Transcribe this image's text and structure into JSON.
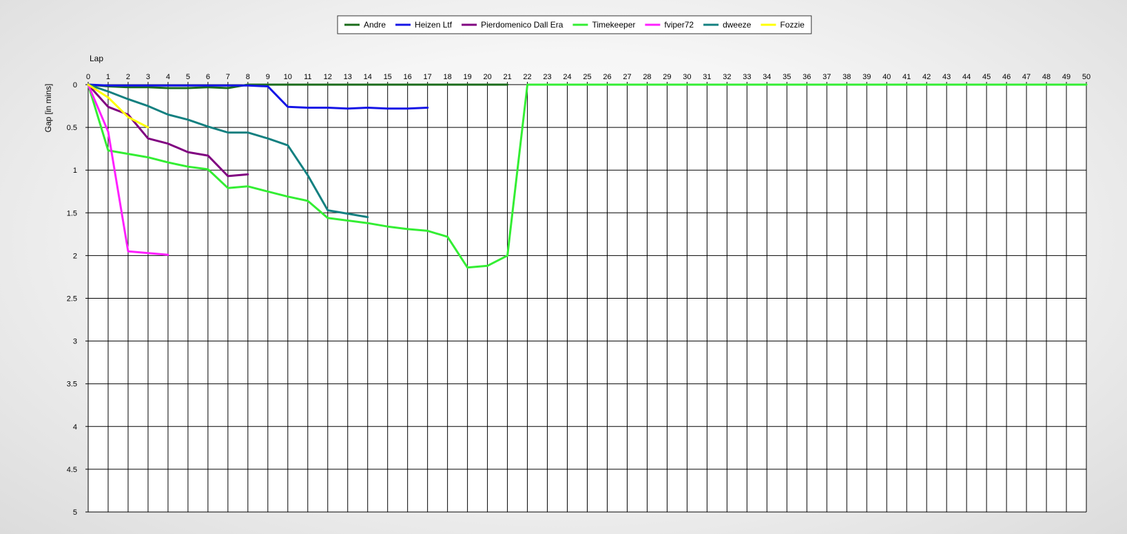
{
  "chart_data": {
    "type": "line",
    "xlabel": "Lap",
    "ylabel": "Gap [in mins]",
    "xlim": [
      0,
      50
    ],
    "ylim": [
      0,
      5
    ],
    "y_inverted": true,
    "x_ticks": [
      0,
      1,
      2,
      3,
      4,
      5,
      6,
      7,
      8,
      9,
      10,
      11,
      12,
      13,
      14,
      15,
      16,
      17,
      18,
      19,
      20,
      21,
      22,
      23,
      24,
      25,
      26,
      27,
      28,
      29,
      30,
      31,
      32,
      33,
      34,
      35,
      36,
      37,
      38,
      39,
      40,
      41,
      42,
      43,
      44,
      45,
      46,
      47,
      48,
      49,
      50
    ],
    "y_ticks": [
      {
        "value": 0,
        "label": "0"
      },
      {
        "value": 0.5,
        "label": "0.5"
      },
      {
        "value": 1,
        "label": "1"
      },
      {
        "value": 1.5,
        "label": "1.5"
      },
      {
        "value": 2,
        "label": "2"
      },
      {
        "value": 2.5,
        "label": "2.5"
      },
      {
        "value": 3,
        "label": "3"
      },
      {
        "value": 3.5,
        "label": "3.5"
      },
      {
        "value": 4,
        "label": "4"
      },
      {
        "value": 4.5,
        "label": "4.5"
      },
      {
        "value": 5,
        "label": "5"
      }
    ],
    "grid": true,
    "legend_position": "top-center",
    "series": [
      {
        "name": "Andre",
        "color": "#1a6b1a",
        "points": [
          [
            0,
            0
          ],
          [
            1,
            0.02
          ],
          [
            2,
            0.03
          ],
          [
            3,
            0.03
          ],
          [
            4,
            0.04
          ],
          [
            5,
            0.04
          ],
          [
            6,
            0.03
          ],
          [
            7,
            0.04
          ],
          [
            8,
            0
          ],
          [
            9,
            0
          ],
          [
            10,
            0
          ],
          [
            11,
            0
          ],
          [
            12,
            0
          ],
          [
            13,
            0
          ],
          [
            14,
            0
          ],
          [
            15,
            0
          ],
          [
            16,
            0
          ],
          [
            17,
            0
          ],
          [
            18,
            0
          ],
          [
            19,
            0
          ],
          [
            20,
            0
          ],
          [
            21,
            0
          ]
        ]
      },
      {
        "name": "Heizen Ltf",
        "color": "#1414e6",
        "points": [
          [
            0,
            0
          ],
          [
            1,
            0.01
          ],
          [
            2,
            0.01
          ],
          [
            3,
            0.01
          ],
          [
            4,
            0.01
          ],
          [
            5,
            0.01
          ],
          [
            6,
            0.01
          ],
          [
            7,
            0.01
          ],
          [
            8,
            0.01
          ],
          [
            9,
            0.02
          ],
          [
            10,
            0.26
          ],
          [
            11,
            0.27
          ],
          [
            12,
            0.27
          ],
          [
            13,
            0.28
          ],
          [
            14,
            0.27
          ],
          [
            15,
            0.28
          ],
          [
            16,
            0.28
          ],
          [
            17,
            0.27
          ]
        ]
      },
      {
        "name": "Pierdomenico Dall Era",
        "color": "#800080",
        "points": [
          [
            0,
            0
          ],
          [
            1,
            0.26
          ],
          [
            2,
            0.35
          ],
          [
            3,
            0.63
          ],
          [
            4,
            0.69
          ],
          [
            5,
            0.79
          ],
          [
            6,
            0.83
          ],
          [
            7,
            1.07
          ],
          [
            8,
            1.05
          ]
        ]
      },
      {
        "name": "Timekeeper",
        "color": "#33ee33",
        "points": [
          [
            0,
            0
          ],
          [
            1,
            0.77
          ],
          [
            2,
            0.81
          ],
          [
            3,
            0.85
          ],
          [
            4,
            0.91
          ],
          [
            5,
            0.96
          ],
          [
            6,
            0.99
          ],
          [
            7,
            1.21
          ],
          [
            8,
            1.19
          ],
          [
            9,
            1.25
          ],
          [
            10,
            1.31
          ],
          [
            11,
            1.36
          ],
          [
            12,
            1.56
          ],
          [
            13,
            1.59
          ],
          [
            14,
            1.62
          ],
          [
            15,
            1.66
          ],
          [
            16,
            1.69
          ],
          [
            17,
            1.71
          ],
          [
            18,
            1.78
          ],
          [
            19,
            2.14
          ],
          [
            20,
            2.12
          ],
          [
            21,
            2.0
          ],
          [
            22,
            0
          ],
          [
            23,
            0
          ],
          [
            24,
            0
          ],
          [
            25,
            0
          ],
          [
            26,
            0
          ],
          [
            27,
            0
          ],
          [
            28,
            0
          ],
          [
            29,
            0
          ],
          [
            30,
            0
          ],
          [
            31,
            0
          ],
          [
            32,
            0
          ],
          [
            33,
            0
          ],
          [
            34,
            0
          ],
          [
            35,
            0
          ],
          [
            36,
            0
          ],
          [
            37,
            0
          ],
          [
            38,
            0
          ],
          [
            39,
            0
          ],
          [
            40,
            0
          ],
          [
            41,
            0
          ],
          [
            42,
            0
          ],
          [
            43,
            0
          ],
          [
            44,
            0
          ],
          [
            45,
            0
          ],
          [
            46,
            0
          ],
          [
            47,
            0
          ],
          [
            48,
            0
          ],
          [
            49,
            0
          ],
          [
            50,
            0
          ]
        ]
      },
      {
        "name": "fviper72",
        "color": "#ff20ff",
        "points": [
          [
            0,
            0
          ],
          [
            1,
            0.55
          ],
          [
            2,
            1.95
          ],
          [
            3,
            1.97
          ],
          [
            4,
            1.99
          ]
        ]
      },
      {
        "name": "dweeze",
        "color": "#138080",
        "points": [
          [
            0,
            0
          ],
          [
            1,
            0.08
          ],
          [
            2,
            0.17
          ],
          [
            3,
            0.25
          ],
          [
            4,
            0.35
          ],
          [
            5,
            0.41
          ],
          [
            6,
            0.49
          ],
          [
            7,
            0.56
          ],
          [
            8,
            0.56
          ],
          [
            9,
            0.63
          ],
          [
            10,
            0.71
          ],
          [
            11,
            1.06
          ],
          [
            12,
            1.47
          ],
          [
            13,
            1.51
          ],
          [
            14,
            1.55
          ]
        ]
      },
      {
        "name": "Fozzie",
        "color": "#ffff00",
        "points": [
          [
            0,
            0
          ],
          [
            1,
            0.15
          ],
          [
            2,
            0.38
          ],
          [
            3,
            0.5
          ]
        ]
      }
    ]
  }
}
